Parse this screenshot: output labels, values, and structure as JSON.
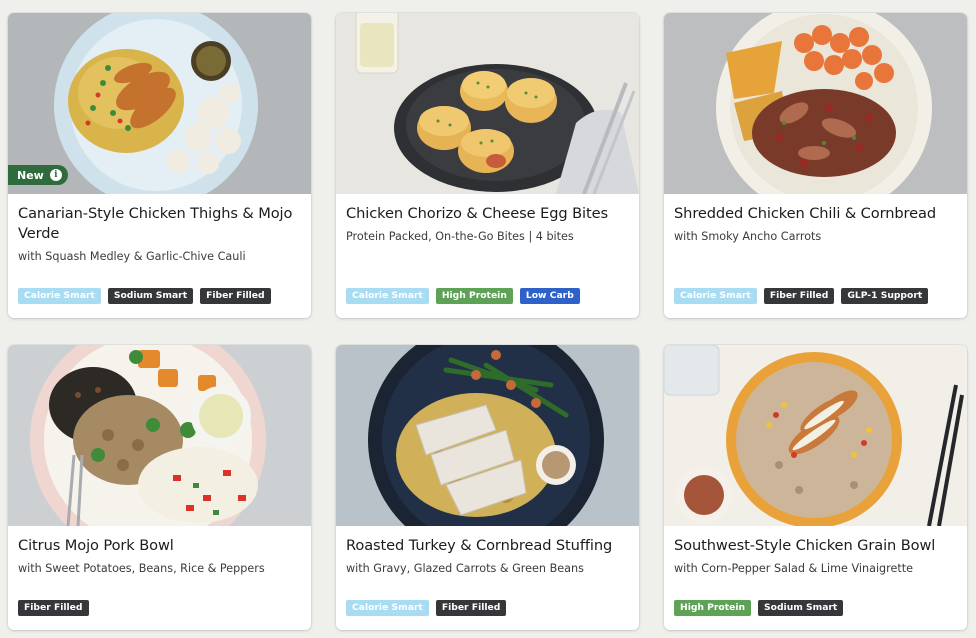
{
  "colors": {
    "page_bg": "#efefec",
    "tag_calorie_smart": "#a8dcf3",
    "tag_dark": "#36373a",
    "tag_high_protein": "#5ea257",
    "tag_low_carb": "#2f62c8",
    "new_badge": "#2f6b3d"
  },
  "cards": [
    {
      "title": "Canarian-Style Chicken Thighs & Mojo Verde",
      "subtitle": "with Squash Medley & Garlic-Chive Cauli",
      "badge": "New",
      "tags": [
        "Calorie Smart",
        "Sodium Smart",
        "Fiber Filled"
      ],
      "image": "chicken-thighs-plate-photo"
    },
    {
      "title": "Chicken Chorizo & Cheese Egg Bites",
      "subtitle": "Protein Packed, On-the-Go Bites | 4 bites",
      "tags": [
        "Calorie Smart",
        "High Protein",
        "Low Carb"
      ],
      "image": "egg-bites-plate-photo"
    },
    {
      "title": "Shredded Chicken Chili & Cornbread",
      "subtitle": "with Smoky Ancho Carrots",
      "tags": [
        "Calorie Smart",
        "Fiber Filled",
        "GLP-1 Support"
      ],
      "image": "chicken-chili-plate-photo"
    },
    {
      "title": "Citrus Mojo Pork Bowl",
      "subtitle": "with Sweet Potatoes, Beans, Rice & Peppers",
      "tags": [
        "Fiber Filled"
      ],
      "image": "pork-bowl-photo"
    },
    {
      "title": "Roasted Turkey & Cornbread Stuffing",
      "subtitle": "with Gravy, Glazed Carrots & Green Beans",
      "tags": [
        "Calorie Smart",
        "Fiber Filled"
      ],
      "image": "turkey-plate-photo"
    },
    {
      "title": "Southwest-Style Chicken Grain Bowl",
      "subtitle": "with Corn-Pepper Salad & Lime Vinaigrette",
      "tags": [
        "High Protein",
        "Sodium Smart"
      ],
      "image": "grain-bowl-photo"
    }
  ]
}
